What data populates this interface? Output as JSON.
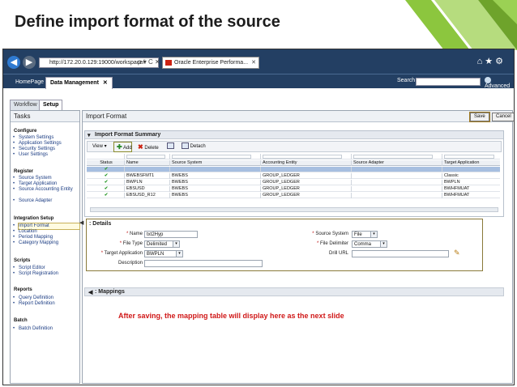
{
  "slide": {
    "title": "Define import format of the source",
    "accent_color": "#8cc63e",
    "accent_dark": "#6ea32b"
  },
  "browser": {
    "address": "http://172.20.0.129:19000/workspace/i",
    "address_icons": "ρ ▾ C ✕",
    "tab_title": "Oracle Enterprise Performa...",
    "tab_close": "✕",
    "right_icons": "⌂★⚙",
    "back_icon": "◀",
    "fwd_icon": "▶"
  },
  "app": {
    "tabs": [
      "HomePage",
      "Data Management"
    ],
    "active_tab_close": "✕",
    "search_label": "Search",
    "advanced_label": "Advanced"
  },
  "side_tabs": [
    "Workflow",
    "Setup"
  ],
  "tasks": {
    "title": "Tasks",
    "groups": [
      {
        "name": "Configure",
        "items": [
          "System Settings",
          "Application Settings",
          "Security Settings",
          "User Settings"
        ]
      },
      {
        "name": "Register",
        "items": [
          "Source System",
          "Target Application",
          "Source Accounting Entity",
          "Source Adapter"
        ]
      },
      {
        "name": "Integration Setup",
        "items": [
          "Import Format",
          "Location",
          "Period Mapping",
          "Category Mapping"
        ]
      },
      {
        "name": "Scripts",
        "items": [
          "Script Editor",
          "Script Registration"
        ]
      },
      {
        "name": "Reports",
        "items": [
          "Query Definition",
          "Report Definition"
        ]
      },
      {
        "name": "Batch",
        "items": [
          "Batch Definition"
        ]
      }
    ]
  },
  "main": {
    "title": "Import Format",
    "save_label": "Save",
    "cancel_label": "Cancel",
    "summary": {
      "title": "Import Format Summary",
      "collapse_icon": "▾",
      "toolbar": {
        "view": "View ▾",
        "add": "Add",
        "delete": "Delete",
        "detach": "Detach"
      },
      "columns": [
        "Status",
        "Name",
        "Source System",
        "Accounting Entity",
        "Source Adapter",
        "Target Application"
      ],
      "rows": [
        {
          "status": "✔",
          "name": "",
          "source": "",
          "entity": "",
          "adapter": "",
          "target": ""
        },
        {
          "status": "✔",
          "name": "BWEBSFMT1",
          "source": "BWEBS",
          "entity": "GROUP_LEDGER",
          "adapter": "",
          "target": "Classic"
        },
        {
          "status": "✔",
          "name": "BWPLN",
          "source": "BWEBS",
          "entity": "GROUP_LEDGER",
          "adapter": "",
          "target": "BWPLN"
        },
        {
          "status": "✔",
          "name": "EBSUSD",
          "source": "BWEBS",
          "entity": "GROUP_LEDGER",
          "adapter": "",
          "target": "BWHFMUAT"
        },
        {
          "status": "✔",
          "name": "EBSUSD_R12",
          "source": "BWEBS",
          "entity": "GROUP_LEDGER",
          "adapter": "",
          "target": "BWHFMUAT"
        }
      ]
    },
    "details": {
      "title": ": Details",
      "name_label": "Name",
      "name_value": "txt2Hyp",
      "file_type_label": "File Type",
      "file_type_value": "Delimited",
      "target_app_label": "Target Application",
      "target_app_value": "BWPLN",
      "description_label": "Description",
      "description_value": "",
      "source_system_label": "Source System",
      "source_system_value": "File",
      "file_delimiter_label": "File Delimiter",
      "file_delimiter_value": "Comma",
      "drill_url_label": "Drill URL",
      "drill_url_value": "",
      "required_mark": "*",
      "dropdown_glyph": "▾",
      "pencil_glyph": "✎",
      "collapse_glyph": "◀"
    },
    "mappings": {
      "title": ": Mappings"
    },
    "note": "After saving, the mapping table will display here as the next slide"
  }
}
